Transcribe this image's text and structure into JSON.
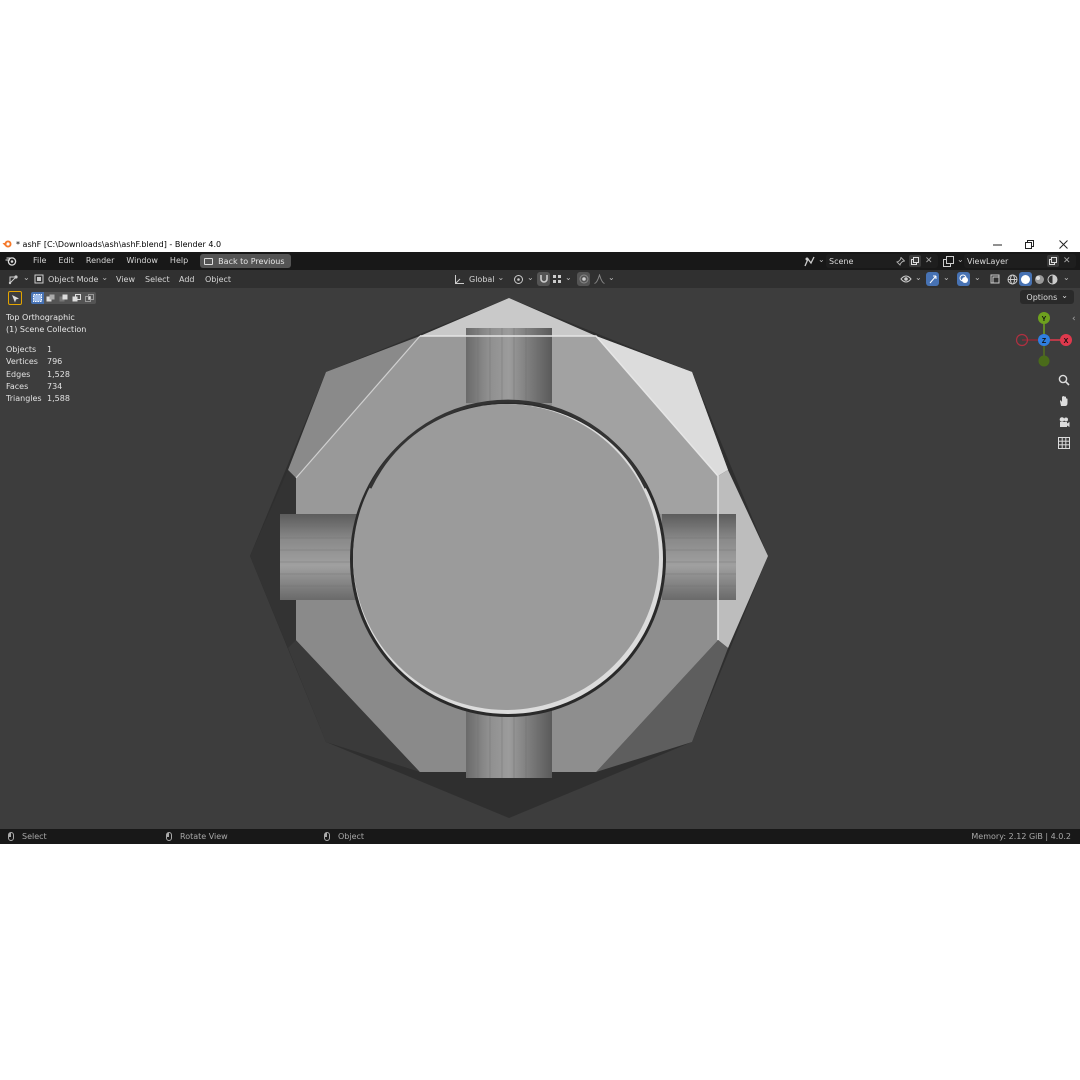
{
  "window": {
    "title": "* ashF [C:\\Downloads\\ash\\ashF.blend] - Blender 4.0",
    "minimize_icon": "minimize-icon",
    "maximize_icon": "restore-icon",
    "close_icon": "close-icon"
  },
  "topbar": {
    "menus": [
      "File",
      "Edit",
      "Render",
      "Window",
      "Help"
    ],
    "back_label": "Back to Previous",
    "scene_label": "Scene",
    "viewlayer_label": "ViewLayer"
  },
  "viewport_header": {
    "mode_label": "Object Mode",
    "menus": [
      "View",
      "Select",
      "Add",
      "Object"
    ],
    "orientation_label": "Global"
  },
  "viewport": {
    "view_name": "Top Orthographic",
    "collection": "(1) Scene Collection",
    "options_label": "Options",
    "stats": [
      {
        "label": "Objects",
        "value": "1"
      },
      {
        "label": "Vertices",
        "value": "796"
      },
      {
        "label": "Edges",
        "value": "1,528"
      },
      {
        "label": "Faces",
        "value": "734"
      },
      {
        "label": "Triangles",
        "value": "1,588"
      }
    ],
    "gizmo": {
      "y": "Y",
      "z": "Z",
      "x": "X",
      "y_color": "#6ea11e",
      "x_color": "#e0394d",
      "z_color": "#2f7fe0"
    }
  },
  "statusbar": {
    "select_label": "Select",
    "rotate_label": "Rotate View",
    "object_label": "Object",
    "memory": "Memory: 2.12 GiB | 4.0.2"
  },
  "colors": {
    "accent": "#4772b3",
    "viewport_bg": "#3d3d3d"
  }
}
